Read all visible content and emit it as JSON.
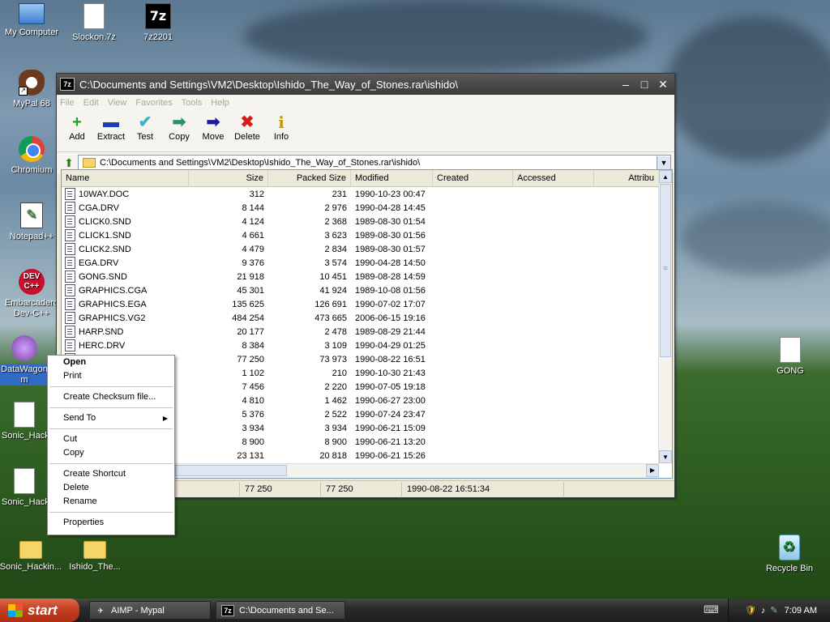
{
  "desktop": {
    "icons": [
      {
        "label": "My Computer"
      },
      {
        "label": "Slockon.7z"
      },
      {
        "label": "7z2201"
      },
      {
        "label": "MyPal 68"
      },
      {
        "label": "Chromium"
      },
      {
        "label": "Notepad++"
      },
      {
        "label": "Embarcadero Dev-C++"
      },
      {
        "label": "DataWagon m"
      },
      {
        "label": "Sonic_Hackin..."
      },
      {
        "label": "Sonic_Hacki..."
      },
      {
        "label": "Sonic_Hackin..."
      },
      {
        "label": "Ishido_The..."
      },
      {
        "label": "GONG"
      },
      {
        "label": "Recycle Bin"
      }
    ],
    "icon_glyphs": {
      "z7": "7z",
      "dev": "DEV\nC++",
      "shortcut": "↗"
    }
  },
  "window": {
    "title": "C:\\Documents and Settings\\VM2\\Desktop\\Ishido_The_Way_of_Stones.rar\\ishido\\",
    "app_icon": "7z",
    "controls": {
      "minimize": "–",
      "maximize": "□",
      "close": "✕"
    },
    "menu": [
      "File",
      "Edit",
      "View",
      "Favorites",
      "Tools",
      "Help"
    ],
    "toolbar": [
      {
        "label": "Add",
        "icon": "+",
        "color": "#1aa61a"
      },
      {
        "label": "Extract",
        "icon": "▬",
        "color": "#1c3fb5"
      },
      {
        "label": "Test",
        "icon": "✔",
        "color": "#38b5c9"
      },
      {
        "label": "Copy",
        "icon": "➡",
        "color": "#2f8f6a"
      },
      {
        "label": "Move",
        "icon": "➡",
        "color": "#1c1c9c"
      },
      {
        "label": "Delete",
        "icon": "✖",
        "color": "#d41c1c"
      },
      {
        "label": "Info",
        "icon": "i",
        "color": "#c99700"
      }
    ],
    "address": "C:\\Documents and Settings\\VM2\\Desktop\\Ishido_The_Way_of_Stones.rar\\ishido\\",
    "up_icon": "⬆",
    "columns": [
      "Name",
      "Size",
      "Packed Size",
      "Modified",
      "Created",
      "Accessed",
      "Attribu"
    ],
    "rows": [
      [
        "10WAY.DOC",
        "312",
        "231",
        "1990-10-23 00:47"
      ],
      [
        "CGA.DRV",
        "8 144",
        "2 976",
        "1990-04-28 14:45"
      ],
      [
        "CLICK0.SND",
        "4 124",
        "2 368",
        "1989-08-30 01:54"
      ],
      [
        "CLICK1.SND",
        "4 661",
        "3 623",
        "1989-08-30 01:56"
      ],
      [
        "CLICK2.SND",
        "4 479",
        "2 834",
        "1989-08-30 01:57"
      ],
      [
        "EGA.DRV",
        "9 376",
        "3 574",
        "1990-04-28 14:50"
      ],
      [
        "GONG.SND",
        "21 918",
        "10 451",
        "1989-08-28 14:59"
      ],
      [
        "GRAPHICS.CGA",
        "45 301",
        "41 924",
        "1989-10-08 01:56"
      ],
      [
        "GRAPHICS.EGA",
        "135 625",
        "126 691",
        "1990-07-02 17:07"
      ],
      [
        "GRAPHICS.VG2",
        "484 254",
        "473 665",
        "2006-06-15 19:16"
      ],
      [
        "HARP.SND",
        "20 177",
        "2 478",
        "1989-08-29 21:44"
      ],
      [
        "HERC.DRV",
        "8 384",
        "3 109",
        "1990-04-29 01:25"
      ],
      [
        "",
        "77 250",
        "73 973",
        "1990-08-22 16:51"
      ],
      [
        "",
        "1 102",
        "210",
        "1990-10-30 21:43"
      ],
      [
        "",
        "7 456",
        "2 220",
        "1990-07-05 19:18"
      ],
      [
        "",
        "4 810",
        "1 462",
        "1990-06-27 23:00"
      ],
      [
        "",
        "5 376",
        "2 522",
        "1990-07-24 23:47"
      ],
      [
        "",
        "3 934",
        "3 934",
        "1990-06-21 15:09"
      ],
      [
        "",
        "8 900",
        "8 900",
        "1990-06-21 13:20"
      ],
      [
        "",
        "23 131",
        "20 818",
        "1990-06-21 15:26"
      ]
    ],
    "status": [
      "",
      "77 250",
      "77 250",
      "1990-08-22 16:51:34"
    ],
    "scroll_arrows": {
      "up": "▲",
      "down": "▼",
      "right": "▶",
      "grip": "≡"
    }
  },
  "context_menu": {
    "items": [
      {
        "label": "Open",
        "bold": true
      },
      {
        "label": "Print"
      },
      {
        "sep": true
      },
      {
        "label": "Create Checksum file..."
      },
      {
        "sep": true
      },
      {
        "label": "Send To",
        "submenu": "▶"
      },
      {
        "sep": true
      },
      {
        "label": "Cut"
      },
      {
        "label": "Copy"
      },
      {
        "sep": true
      },
      {
        "label": "Create Shortcut"
      },
      {
        "label": "Delete"
      },
      {
        "label": "Rename"
      },
      {
        "sep": true
      },
      {
        "label": "Properties"
      }
    ]
  },
  "taskbar": {
    "start": "start",
    "tasks": [
      {
        "label": "AIMP - Mypal",
        "icon": "✈"
      },
      {
        "label": "C:\\Documents and Se...",
        "icon": "7z"
      }
    ],
    "tray": {
      "icons": [
        "⌨",
        "🛡",
        "♪",
        "✎"
      ],
      "clock": "7:09 AM"
    }
  }
}
